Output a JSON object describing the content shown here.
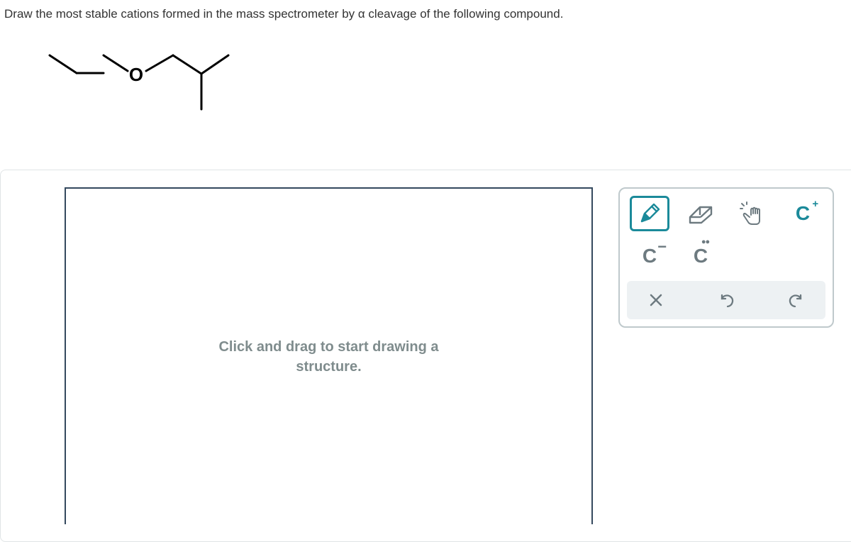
{
  "question": "Draw the most stable cations formed in the mass spectrometer by α cleavage of the following compound.",
  "canvas": {
    "placeholder": "Click and drag to start drawing a structure."
  },
  "molecule": {
    "oxygen_label": "O"
  },
  "tools": {
    "pencil": "pencil-icon",
    "eraser": "eraser-icon",
    "hand": "hand-icon",
    "c_plus": "C",
    "c_minus": "C",
    "c_lonepair": "C",
    "clear": "clear-icon",
    "undo": "undo-icon",
    "redo": "redo-icon"
  }
}
